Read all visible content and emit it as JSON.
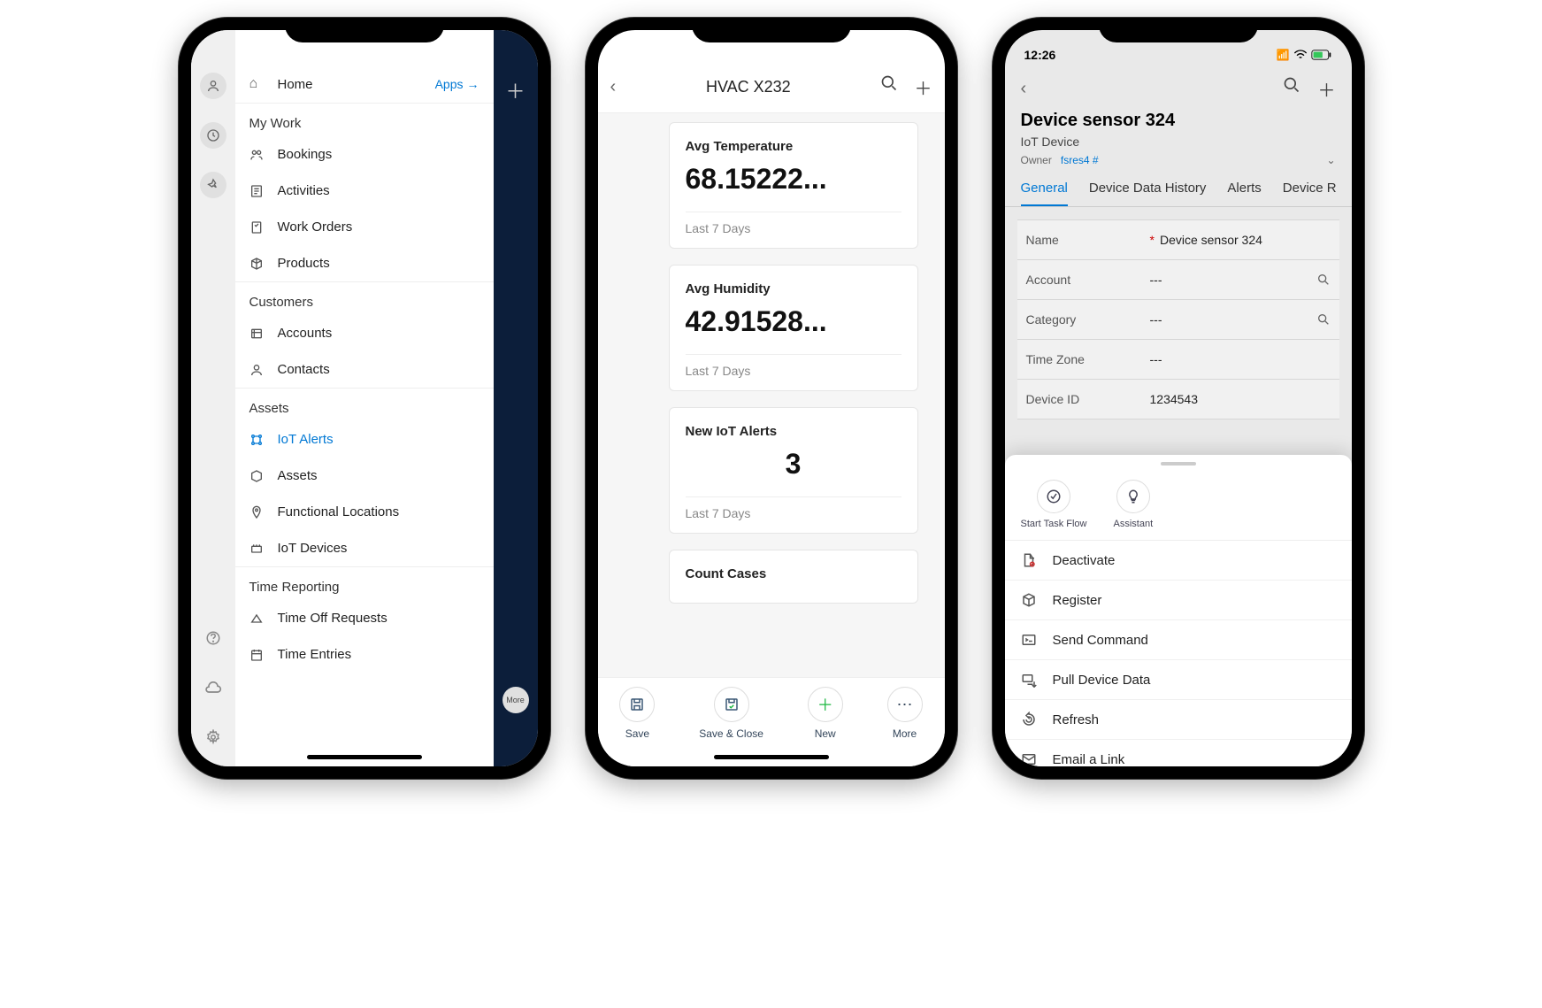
{
  "phone1": {
    "home_label": "Home",
    "apps_link": "Apps",
    "sections": [
      {
        "title": "My Work",
        "items": [
          "Bookings",
          "Activities",
          "Work Orders",
          "Products"
        ]
      },
      {
        "title": "Customers",
        "items": [
          "Accounts",
          "Contacts"
        ]
      },
      {
        "title": "Assets",
        "items": [
          "IoT Alerts",
          "Assets",
          "Functional Locations",
          "IoT Devices"
        ],
        "active_index": 0
      },
      {
        "title": "Time Reporting",
        "items": [
          "Time Off Requests",
          "Time Entries"
        ]
      }
    ],
    "overflow_label": "More"
  },
  "phone2": {
    "title": "HVAC X232",
    "cards": [
      {
        "label": "Avg Temperature",
        "value": "68.15222...",
        "sub": "Last 7 Days"
      },
      {
        "label": "Avg Humidity",
        "value": "42.91528...",
        "sub": "Last 7 Days"
      },
      {
        "label": "New IoT Alerts",
        "value": "3",
        "sub": "Last 7 Days",
        "center": true
      },
      {
        "label": "Count Cases",
        "value": "",
        "sub": ""
      }
    ],
    "toolbar": {
      "save": "Save",
      "save_close": "Save & Close",
      "new": "New",
      "more": "More"
    }
  },
  "phone3": {
    "status_time": "12:26",
    "title": "Device sensor 324",
    "subtitle": "IoT Device",
    "owner_label": "Owner",
    "owner_value": "fsres4 #",
    "tabs": [
      "General",
      "Device Data History",
      "Alerts",
      "Device R"
    ],
    "active_tab": 0,
    "fields": [
      {
        "label": "Name",
        "value": "Device sensor 324",
        "required": true
      },
      {
        "label": "Account",
        "value": "---",
        "search": true
      },
      {
        "label": "Category",
        "value": "---",
        "search": true
      },
      {
        "label": "Time Zone",
        "value": "---"
      },
      {
        "label": "Device ID",
        "value": "1234543"
      }
    ],
    "sheet_top": [
      {
        "label": "Start Task Flow",
        "icon": "task-flow-icon"
      },
      {
        "label": "Assistant",
        "icon": "bulb-icon"
      }
    ],
    "sheet_actions": [
      {
        "label": "Deactivate",
        "icon": "deactivate-icon"
      },
      {
        "label": "Register",
        "icon": "register-icon"
      },
      {
        "label": "Send Command",
        "icon": "command-icon"
      },
      {
        "label": "Pull Device Data",
        "icon": "pull-data-icon"
      },
      {
        "label": "Refresh",
        "icon": "refresh-icon"
      },
      {
        "label": "Email a Link",
        "icon": "email-icon"
      }
    ]
  }
}
